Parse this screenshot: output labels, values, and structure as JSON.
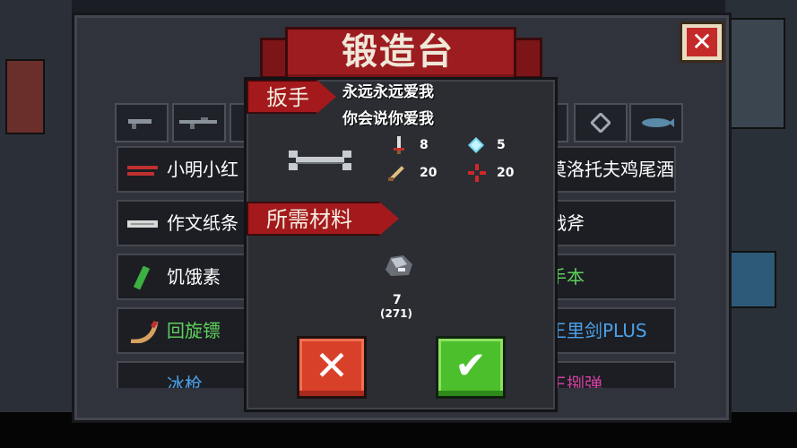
{
  "colors": {
    "accent_red": "#a3191c",
    "confirm_green": "#4cc02c",
    "cancel_red": "#d9402a",
    "green_text": "#5ed05c",
    "blue_text": "#4aa0e8",
    "pink_text": "#d040a0"
  },
  "title": "锻造台",
  "close_icon": "✕",
  "category_tabs": [
    {
      "icon": "pistol-icon"
    },
    {
      "icon": "rifle-icon"
    },
    {
      "icon": "weapon-icon"
    },
    {
      "icon": "fish-gun-icon-hidden"
    },
    {
      "icon": "shotgun-icon"
    },
    {
      "icon": "orb-icon"
    },
    {
      "icon": "fish-gun-icon"
    }
  ],
  "weapon_list": [
    {
      "left": "小明小红",
      "right": "莫洛托夫鸡尾酒",
      "left_color": "#ffffff",
      "right_color": "#ffffff"
    },
    {
      "left": "作文纸条",
      "right": "战斧",
      "left_color": "#ffffff",
      "right_color": "#ffffff"
    },
    {
      "left": "饥饿素",
      "right": "手本",
      "left_color": "#ffffff",
      "right_color": "#5ed05c"
    },
    {
      "left": "回旋镖",
      "right": "王里剑PLUS",
      "left_color": "#5ed05c",
      "right_color": "#4aa0e8"
    },
    {
      "left": "冰枪",
      "right": "王捌弹",
      "left_color": "#4aa0e8",
      "right_color": "#d040a0"
    }
  ],
  "modal": {
    "weapon_name": "扳手",
    "speech_line1": "永远永远爱我",
    "speech_line2": "你会说你爱我",
    "stats": {
      "damage": "8",
      "energy": "5",
      "crit": "20",
      "accuracy": "20"
    },
    "materials_label": "所需材料",
    "material_count": "7",
    "material_owned": "(271)",
    "cancel_icon": "✕",
    "confirm_icon": "✔"
  }
}
